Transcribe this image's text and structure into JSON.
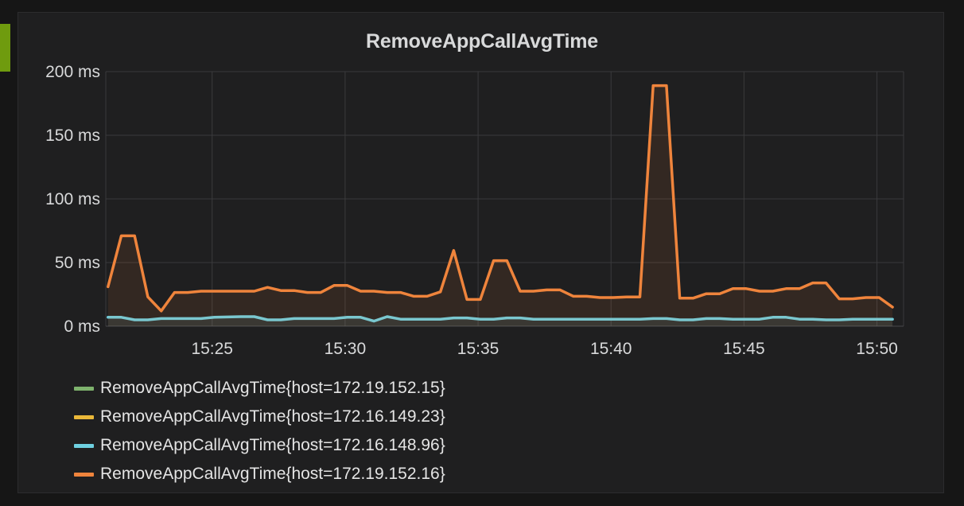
{
  "panel": {
    "title": "RemoveAppCallAvgTime",
    "accent_color": "#6f9b0e"
  },
  "legend": [
    {
      "label": "RemoveAppCallAvgTime{host=172.19.152.15}",
      "color": "#7eb26d"
    },
    {
      "label": "RemoveAppCallAvgTime{host=172.16.149.23}",
      "color": "#eab839"
    },
    {
      "label": "RemoveAppCallAvgTime{host=172.16.148.96}",
      "color": "#6ed0e0"
    },
    {
      "label": "RemoveAppCallAvgTime{host=172.19.152.16}",
      "color": "#ef843c"
    }
  ],
  "chart_data": {
    "type": "area",
    "title": "RemoveAppCallAvgTime",
    "x_unit": "time",
    "xlim": [
      "15:21:00",
      "15:51:00"
    ],
    "y_unit": "ms",
    "ylim": [
      0,
      200
    ],
    "y_ticks": [
      0,
      50,
      100,
      150,
      200
    ],
    "y_tick_labels": [
      "0 ms",
      "50 ms",
      "100 ms",
      "150 ms",
      "200 ms"
    ],
    "x_ticks": [
      "15:25",
      "15:30",
      "15:35",
      "15:40",
      "15:45",
      "15:50"
    ],
    "grid": true,
    "legend_position": "bottom-left",
    "series": [
      {
        "name": "RemoveAppCallAvgTime{host=172.19.152.15}",
        "color": "#7eb26d",
        "points": []
      },
      {
        "name": "RemoveAppCallAvgTime{host=172.16.149.23}",
        "color": "#eab839",
        "points": []
      },
      {
        "name": "RemoveAppCallAvgTime{host=172.16.148.96}",
        "color": "#6ed0e0",
        "points": [
          [
            "15:21:05",
            7
          ],
          [
            "15:21:35",
            7
          ],
          [
            "15:22:05",
            5
          ],
          [
            "15:22:35",
            5
          ],
          [
            "15:23:05",
            6
          ],
          [
            "15:23:35",
            6
          ],
          [
            "15:24:35",
            6
          ],
          [
            "15:25:05",
            7
          ],
          [
            "15:26:05",
            7.5
          ],
          [
            "15:26:35",
            7.5
          ],
          [
            "15:27:05",
            5
          ],
          [
            "15:27:35",
            5
          ],
          [
            "15:28:05",
            6
          ],
          [
            "15:28:35",
            6
          ],
          [
            "15:29:05",
            6
          ],
          [
            "15:29:35",
            6
          ],
          [
            "15:30:05",
            7
          ],
          [
            "15:30:35",
            7
          ],
          [
            "15:31:05",
            4
          ],
          [
            "15:31:35",
            7.5
          ],
          [
            "15:32:05",
            5.5
          ],
          [
            "15:33:35",
            5.5
          ],
          [
            "15:34:05",
            6.5
          ],
          [
            "15:34:35",
            6.5
          ],
          [
            "15:35:05",
            5.5
          ],
          [
            "15:35:35",
            5.5
          ],
          [
            "15:36:05",
            6.5
          ],
          [
            "15:36:35",
            6.5
          ],
          [
            "15:37:05",
            5.5
          ],
          [
            "15:41:05",
            5.5
          ],
          [
            "15:41:35",
            6
          ],
          [
            "15:42:05",
            6
          ],
          [
            "15:42:35",
            5
          ],
          [
            "15:43:05",
            5
          ],
          [
            "15:43:35",
            6
          ],
          [
            "15:44:05",
            6
          ],
          [
            "15:44:35",
            5.5
          ],
          [
            "15:45:35",
            5.5
          ],
          [
            "15:46:05",
            7
          ],
          [
            "15:46:35",
            7
          ],
          [
            "15:47:05",
            5.5
          ],
          [
            "15:47:35",
            5.5
          ],
          [
            "15:48:05",
            5
          ],
          [
            "15:48:35",
            5
          ],
          [
            "15:49:05",
            5.5
          ],
          [
            "15:50:35",
            5.5
          ]
        ]
      },
      {
        "name": "RemoveAppCallAvgTime{host=172.19.152.16}",
        "color": "#ef843c",
        "points": [
          [
            "15:21:05",
            31
          ],
          [
            "15:21:35",
            71
          ],
          [
            "15:22:05",
            71
          ],
          [
            "15:22:35",
            23
          ],
          [
            "15:23:05",
            12
          ],
          [
            "15:23:35",
            26.5
          ],
          [
            "15:24:05",
            26.5
          ],
          [
            "15:24:35",
            27.5
          ],
          [
            "15:25:05",
            27.5
          ],
          [
            "15:25:35",
            27.5
          ],
          [
            "15:26:05",
            27.5
          ],
          [
            "15:26:35",
            27.5
          ],
          [
            "15:27:05",
            30.5
          ],
          [
            "15:27:35",
            28
          ],
          [
            "15:28:05",
            28
          ],
          [
            "15:28:35",
            26.5
          ],
          [
            "15:29:05",
            26.5
          ],
          [
            "15:29:35",
            32
          ],
          [
            "15:30:05",
            32
          ],
          [
            "15:30:35",
            27.5
          ],
          [
            "15:31:05",
            27.5
          ],
          [
            "15:31:35",
            26.5
          ],
          [
            "15:32:05",
            26.5
          ],
          [
            "15:32:35",
            23.5
          ],
          [
            "15:33:05",
            23.5
          ],
          [
            "15:33:35",
            27
          ],
          [
            "15:34:05",
            59.5
          ],
          [
            "15:34:35",
            21
          ],
          [
            "15:35:05",
            21
          ],
          [
            "15:35:35",
            51.5
          ],
          [
            "15:36:05",
            51.5
          ],
          [
            "15:36:35",
            27.5
          ],
          [
            "15:37:05",
            27.5
          ],
          [
            "15:37:35",
            28.5
          ],
          [
            "15:38:05",
            28.5
          ],
          [
            "15:38:35",
            23.5
          ],
          [
            "15:39:05",
            23.5
          ],
          [
            "15:39:35",
            22.5
          ],
          [
            "15:40:05",
            22.5
          ],
          [
            "15:40:35",
            23
          ],
          [
            "15:41:05",
            23
          ],
          [
            "15:41:35",
            189
          ],
          [
            "15:42:05",
            189
          ],
          [
            "15:42:35",
            22
          ],
          [
            "15:43:05",
            22
          ],
          [
            "15:43:35",
            25.5
          ],
          [
            "15:44:05",
            25.5
          ],
          [
            "15:44:35",
            29.5
          ],
          [
            "15:45:05",
            29.5
          ],
          [
            "15:45:35",
            27.5
          ],
          [
            "15:46:05",
            27.5
          ],
          [
            "15:46:35",
            29.5
          ],
          [
            "15:47:05",
            29.5
          ],
          [
            "15:47:35",
            34
          ],
          [
            "15:48:05",
            34
          ],
          [
            "15:48:35",
            21.5
          ],
          [
            "15:49:05",
            21.5
          ],
          [
            "15:49:35",
            22.5
          ],
          [
            "15:50:05",
            22.5
          ],
          [
            "15:50:35",
            15
          ]
        ]
      }
    ]
  }
}
